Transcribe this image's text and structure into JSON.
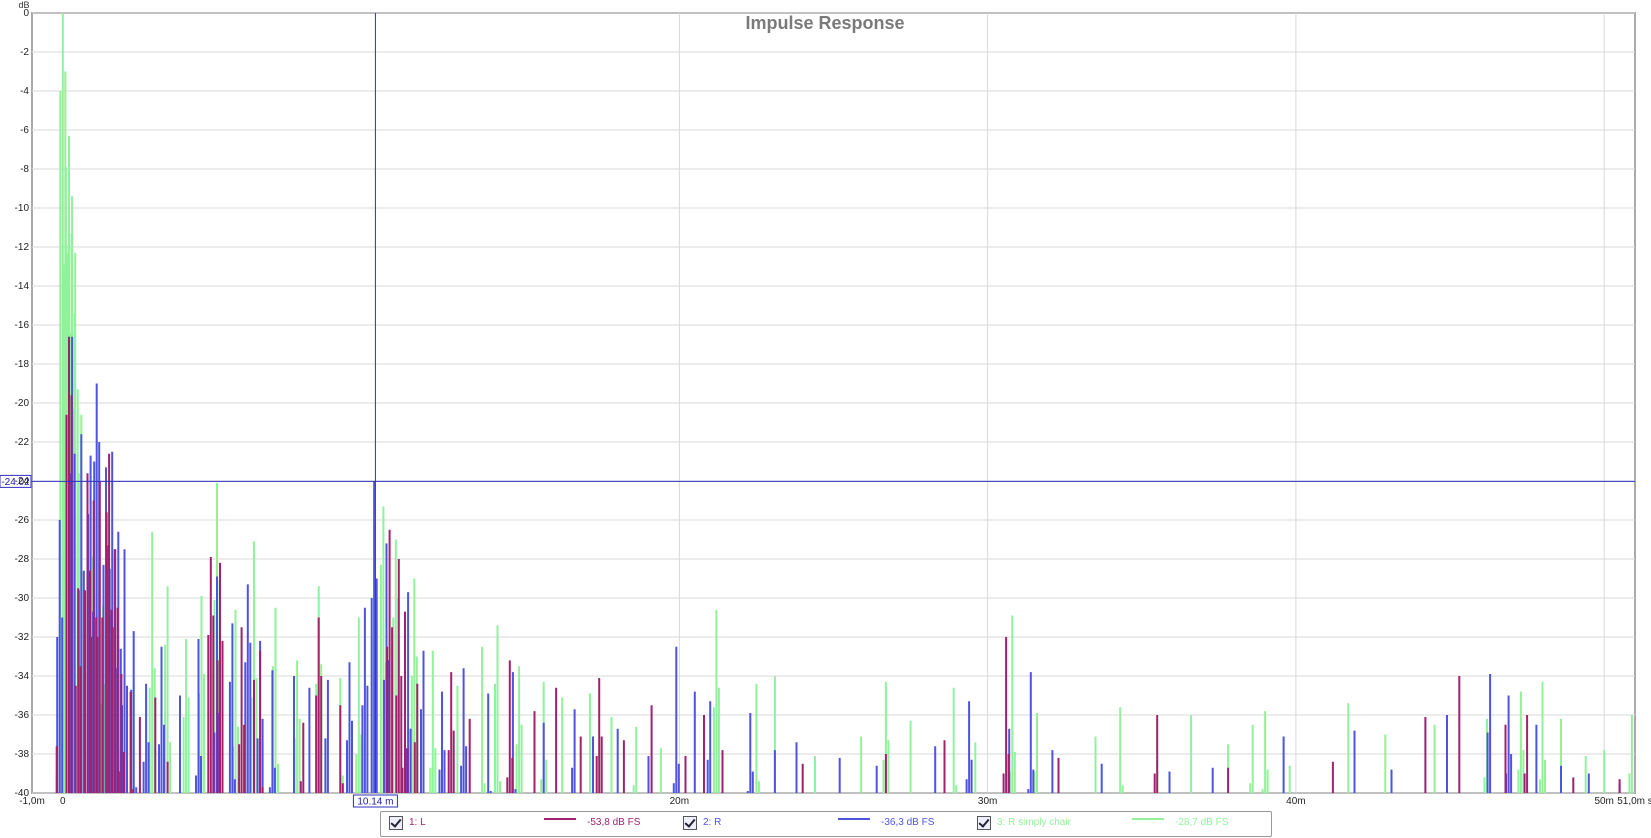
{
  "chart_data": {
    "type": "line",
    "title": "Impulse Response",
    "ylabel": "dB",
    "xlim": [
      -1.0,
      51.0
    ],
    "ylim": [
      -40,
      0
    ],
    "y_ticks": [
      "0",
      "-2",
      "-4",
      "-6",
      "-8",
      "-10",
      "-12",
      "-14",
      "-16",
      "-18",
      "-20",
      "-22",
      "-24",
      "-26",
      "-28",
      "-30",
      "-32",
      "-34",
      "-36",
      "-38",
      "-40"
    ],
    "x_ticks": [
      {
        "value": -1.0,
        "label": "-1,0m"
      },
      {
        "value": 0,
        "label": "0"
      },
      {
        "value": 20,
        "label": "20m"
      },
      {
        "value": 30,
        "label": "30m"
      },
      {
        "value": 40,
        "label": "40m"
      },
      {
        "value": 50,
        "label": "50m"
      },
      {
        "value": 51.0,
        "label": "51,0m s"
      }
    ],
    "grid": true,
    "cursor": {
      "x": 10.14,
      "x_label": "10.14 m",
      "y": -24.02,
      "y_label": "-24.02"
    },
    "series": [
      {
        "name": "1: L",
        "color": "#a0226e",
        "x": [
          -0.2,
          0.2,
          0.5,
          0.8,
          1.0,
          1.2,
          1.5,
          1.7,
          1.9,
          2.2,
          2.5,
          3.0,
          3.4,
          4.8,
          5.1,
          5.8,
          6.2,
          6.4,
          7.8,
          8.3,
          9.0,
          10.6,
          10.9,
          11.1,
          11.5,
          12.6,
          13.2,
          14.5,
          15.3,
          16.0,
          16.8,
          17.4,
          18.2,
          19.1,
          20.2,
          20.8,
          21.4,
          24.0,
          26.7,
          28.6,
          30.6,
          32.3,
          35.5,
          37.8,
          41.2,
          44.2,
          45.3,
          46.8,
          47.5,
          49.0,
          50.5
        ],
        "y": [
          -37.6,
          -16.6,
          -29.5,
          -23.6,
          -25.0,
          -24.0,
          -22.6,
          -27.5,
          -33.9,
          -34.8,
          -36.1,
          -35.1,
          -38.4,
          -27.9,
          -28.2,
          -31.5,
          -34.2,
          -32.7,
          -36.4,
          -31.0,
          -35.5,
          -26.5,
          -28.0,
          -30.7,
          -34.4,
          -33.8,
          -36.2,
          -33.2,
          -35.8,
          -34.6,
          -37.1,
          -34.1,
          -37.3,
          -35.5,
          -38.1,
          -36.0,
          -37.8,
          -38.5,
          -38.0,
          -37.3,
          -32.0,
          -38.2,
          -36.0,
          -38.7,
          -38.4,
          -36.1,
          -34.0,
          -36.5,
          -36.0,
          -39.2,
          -39.3
        ]
      },
      {
        "name": "2: R",
        "color": "#4f54e0",
        "x": [
          -0.1,
          0.3,
          0.6,
          0.9,
          1.1,
          1.4,
          1.6,
          1.8,
          2.0,
          2.3,
          2.7,
          3.2,
          3.8,
          4.4,
          5.0,
          5.5,
          6.0,
          6.4,
          6.8,
          7.5,
          8.0,
          8.6,
          9.3,
          9.8,
          10.1,
          10.5,
          11.2,
          11.7,
          12.3,
          13.0,
          13.8,
          14.6,
          15.6,
          16.6,
          17.2,
          18.0,
          19.0,
          19.9,
          20.5,
          21.0,
          22.3,
          23.1,
          23.8,
          25.2,
          26.4,
          28.3,
          29.4,
          30.7,
          31.4,
          32.1,
          33.7,
          35.9,
          37.3,
          39.6,
          41.9,
          43.1,
          44.9,
          46.3,
          46.9,
          47.8,
          48.6,
          49.5,
          50.5
        ],
        "y": [
          -26.0,
          -16.6,
          -21.6,
          -22.7,
          -19.0,
          -23.3,
          -22.5,
          -26.6,
          -27.5,
          -31.7,
          -34.4,
          -32.5,
          -35.0,
          -32.1,
          -28.9,
          -31.3,
          -29.3,
          -32.2,
          -33.7,
          -34.0,
          -34.6,
          -34.2,
          -33.3,
          -30.5,
          -24.0,
          -27.2,
          -29.7,
          -32.7,
          -34.8,
          -33.6,
          -34.9,
          -33.8,
          -36.4,
          -35.7,
          -37.1,
          -36.7,
          -38.1,
          -32.5,
          -34.8,
          -35.3,
          -35.9,
          -37.8,
          -37.4,
          -38.2,
          -38.6,
          -37.6,
          -35.3,
          -36.7,
          -33.8,
          -37.8,
          -38.5,
          -38.9,
          -38.7,
          -37.1,
          -36.8,
          -38.8,
          -36.0,
          -33.9,
          -35.0,
          -36.5,
          -38.6,
          -39.0,
          -39.5
        ]
      },
      {
        "name": "3: R simply chair",
        "color": "#92f29b",
        "x": [
          -0.2,
          0.0,
          0.1,
          0.2,
          0.3,
          0.4,
          0.6,
          0.9,
          1.3,
          1.8,
          2.3,
          2.9,
          3.4,
          4.0,
          4.5,
          5.0,
          5.6,
          6.2,
          6.9,
          7.6,
          8.3,
          9.0,
          9.6,
          10.1,
          10.4,
          10.8,
          11.4,
          12.0,
          12.8,
          13.6,
          14.1,
          14.8,
          15.6,
          16.2,
          17.1,
          17.8,
          18.6,
          19.4,
          21.2,
          22.5,
          23.1,
          24.4,
          25.9,
          26.7,
          27.5,
          28.9,
          29.6,
          30.8,
          31.6,
          33.5,
          34.3,
          35.5,
          36.6,
          37.8,
          38.6,
          39.0,
          39.8,
          41.7,
          42.9,
          44.5,
          46.2,
          47.3,
          48.0,
          48.6,
          49.4,
          50.0,
          50.9
        ],
        "y": [
          -39.0,
          -0.0,
          -7.9,
          -6.3,
          -9.4,
          -12.3,
          -20.6,
          -24.9,
          -30.4,
          -32.6,
          -34.4,
          -26.6,
          -29.4,
          -32.1,
          -29.9,
          -24.1,
          -30.6,
          -27.1,
          -30.5,
          -33.2,
          -29.4,
          -34.1,
          -31.0,
          -24.2,
          -25.3,
          -27.0,
          -29.0,
          -32.7,
          -34.5,
          -32.5,
          -31.4,
          -33.5,
          -34.3,
          -35.1,
          -34.9,
          -36.1,
          -36.6,
          -37.7,
          -30.6,
          -34.4,
          -34.0,
          -38.1,
          -37.1,
          -34.3,
          -36.3,
          -34.6,
          -37.4,
          -30.9,
          -35.9,
          -37.1,
          -35.6,
          -38.3,
          -36.0,
          -37.5,
          -36.5,
          -35.8,
          -38.6,
          -35.4,
          -37.0,
          -36.5,
          -36.2,
          -34.8,
          -34.3,
          -36.2,
          -38.1,
          -37.8,
          -36.0
        ]
      }
    ],
    "legend": [
      {
        "name": "1: L",
        "value": "-53,8 dB FS",
        "color": "#a0226e",
        "checked": true
      },
      {
        "name": "2: R",
        "value": "-36,3 dB FS",
        "color": "#4f54e0",
        "checked": true
      },
      {
        "name": "3: R simply chair",
        "value": "-28,7 dB FS",
        "color": "#92f29b",
        "checked": true
      }
    ],
    "legend_position": "bottom-center"
  }
}
